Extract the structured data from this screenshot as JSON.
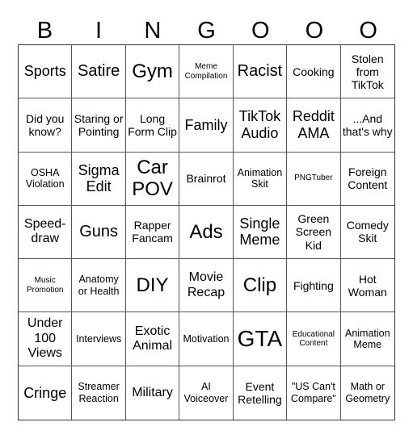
{
  "header": [
    "B",
    "I",
    "N",
    "G",
    "O",
    "O",
    "O"
  ],
  "cells": [
    "Sports",
    "Satire",
    "Gym",
    "Meme Compilation",
    "Racist",
    "Cooking",
    "Stolen from TikTok",
    "Did you know?",
    "Staring or Pointing",
    "Long Form Clip",
    "Family",
    "TikTok Audio",
    "Reddit AMA",
    "...And that's why",
    "OSHA Violation",
    "Sigma Edit",
    "Car POV",
    "Brainrot",
    "Animation Skit",
    "PNGTuber",
    "Foreign Content",
    "Speed-draw",
    "Guns",
    "Rapper Fancam",
    "Ads",
    "Single Meme",
    "Green Screen Kid",
    "Comedy Skit",
    "Music Promotion",
    "Anatomy or Health",
    "DIY",
    "Movie Recap",
    "Clip",
    "Fighting",
    "Hot Woman",
    "Under 100 Views",
    "Interviews",
    "Exotic Animal",
    "Motivation",
    "GTA",
    "Educational Content",
    "Animation Meme",
    "Cringe",
    "Streamer Reaction",
    "Military",
    "AI Voiceover",
    "Event Retelling",
    "\"US Can't Compare\"",
    "Math or Geometry"
  ]
}
